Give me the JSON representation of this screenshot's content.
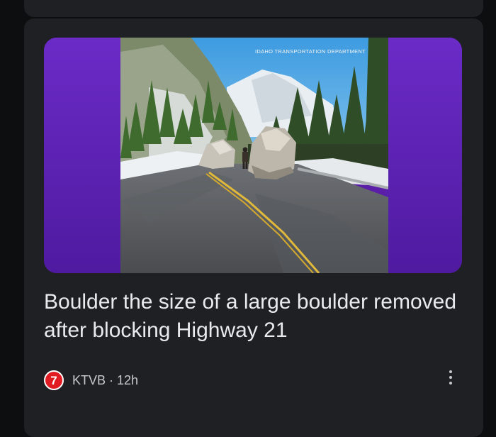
{
  "article": {
    "headline": "Boulder the size of a large boulder removed after blocking Highway 21",
    "image_watermark": "IDAHO TRANSPORTATION DEPARTMENT",
    "source": {
      "logo_text": "7",
      "name": "KTVB",
      "separator": "·",
      "age": "12h"
    }
  },
  "actions": {
    "more_icon": "more-vert-icon"
  },
  "colors": {
    "card_background": "#1f2023",
    "page_background": "#0d0e10",
    "media_frame": "#5a1fa6",
    "logo_red": "#e11b22",
    "headline_text": "#e8eaed"
  }
}
